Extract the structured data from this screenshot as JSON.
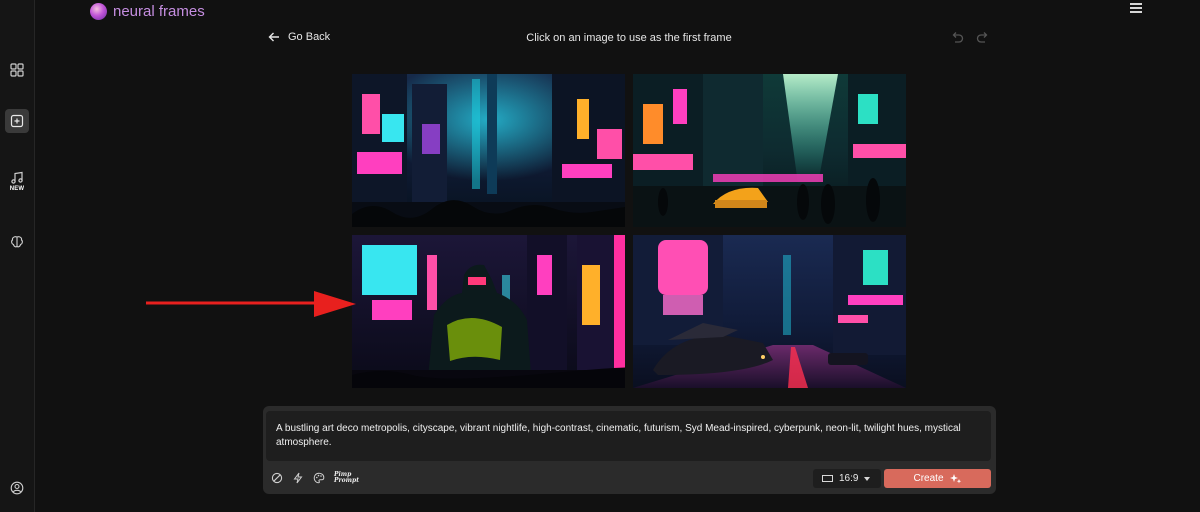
{
  "app": {
    "name": "neural frames"
  },
  "sidebar": {
    "items": [
      {
        "icon": "grid-icon",
        "label": ""
      },
      {
        "icon": "add-square-icon",
        "label": ""
      },
      {
        "icon": "music-note-icon",
        "badge": "NEW"
      },
      {
        "icon": "brain-icon",
        "label": ""
      },
      {
        "icon": "user-icon",
        "label": ""
      }
    ]
  },
  "topbar": {
    "back_label": "Go Back",
    "instruction": "Click on an image to use as the first frame"
  },
  "images": [
    {
      "name": "cyberpunk-city-1",
      "palette": [
        "#0b1530",
        "#ff3fbf",
        "#19e0d8"
      ]
    },
    {
      "name": "cyberpunk-city-2",
      "palette": [
        "#07201f",
        "#2ce0c4",
        "#ff4fa8"
      ]
    },
    {
      "name": "cyberpunk-robot",
      "palette": [
        "#14122a",
        "#ff37a6",
        "#38d5e8"
      ]
    },
    {
      "name": "cyberpunk-city-4",
      "palette": [
        "#0d1530",
        "#ff4fb4",
        "#1fc6e0"
      ]
    }
  ],
  "prompt": {
    "text": "A bustling art deco metropolis, cityscape, vibrant nightlife, high-contrast, cinematic, futurism, Syd Mead-inspired, cyberpunk, neon-lit, twilight hues, mystical atmosphere.",
    "pimp_label_1": "Pimp",
    "pimp_label_2": "Prompt",
    "aspect": "16:9",
    "create_label": "Create"
  },
  "colors": {
    "accent": "#d86a5c",
    "brand": "#c58ee0",
    "arrow": "#e8201e"
  }
}
